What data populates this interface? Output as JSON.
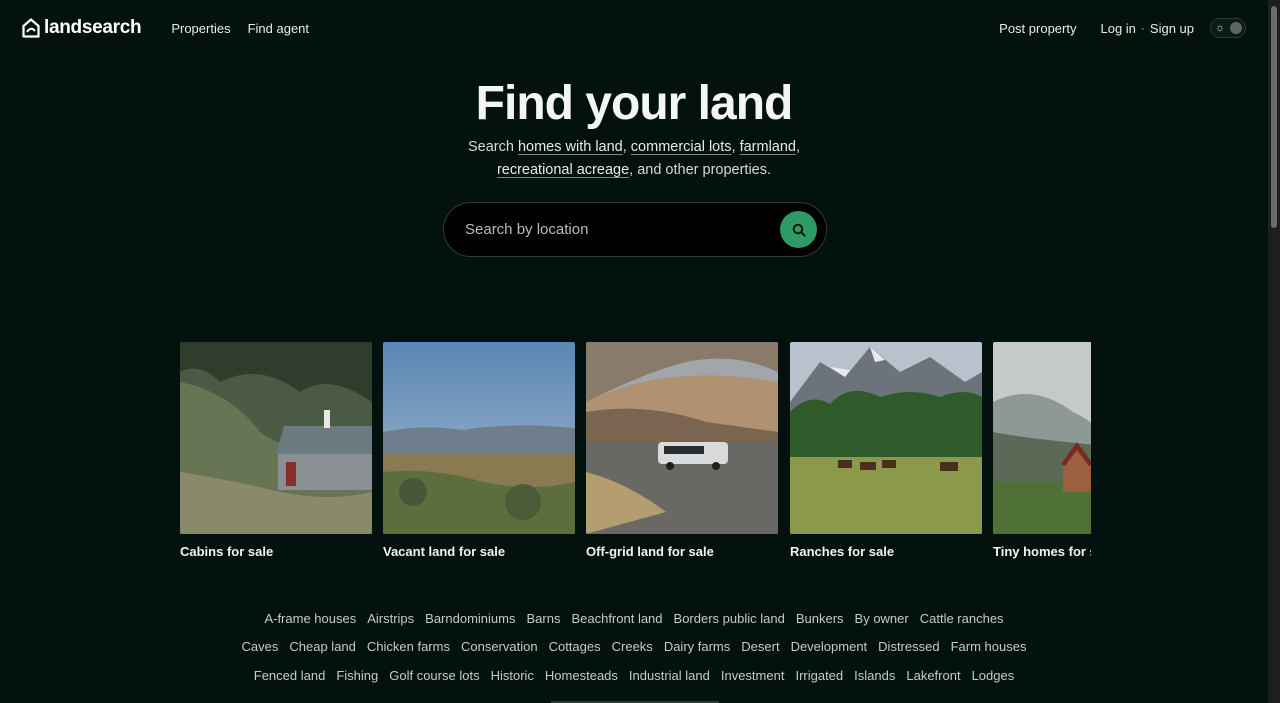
{
  "header": {
    "logo": "landsearch",
    "nav": [
      "Properties",
      "Find agent"
    ],
    "post_property": "Post property",
    "login": "Log in",
    "separator": "·",
    "signup": "Sign up"
  },
  "hero": {
    "title": "Find your land",
    "sub_prefix": "Search ",
    "link_homes": "homes with land",
    "comma1": ", ",
    "link_commercial": "commercial lots",
    "comma2": ", ",
    "link_farmland": "farmland",
    "comma3": ",",
    "link_recreational": "recreational acreage",
    "sub_suffix": ", and other properties."
  },
  "search": {
    "placeholder": "Search by location"
  },
  "cards": [
    {
      "label": "Cabins for sale"
    },
    {
      "label": "Vacant land for sale"
    },
    {
      "label": "Off-grid land for sale"
    },
    {
      "label": "Ranches for sale"
    },
    {
      "label": "Tiny homes for sale"
    }
  ],
  "tags": {
    "row1": [
      "A-frame houses",
      "Airstrips",
      "Barndominiums",
      "Barns",
      "Beachfront land",
      "Borders public land",
      "Bunkers",
      "By owner",
      "Cattle ranches"
    ],
    "row2": [
      "Caves",
      "Cheap land",
      "Chicken farms",
      "Conservation",
      "Cottages",
      "Creeks",
      "Dairy farms",
      "Desert",
      "Development",
      "Distressed",
      "Farm houses"
    ],
    "row3": [
      "Fenced land",
      "Fishing",
      "Golf course lots",
      "Historic",
      "Homesteads",
      "Industrial land",
      "Investment",
      "Irrigated",
      "Islands",
      "Lakefront",
      "Lodges"
    ]
  },
  "colors": {
    "background": "#03110f",
    "accent": "#2e9a64"
  }
}
